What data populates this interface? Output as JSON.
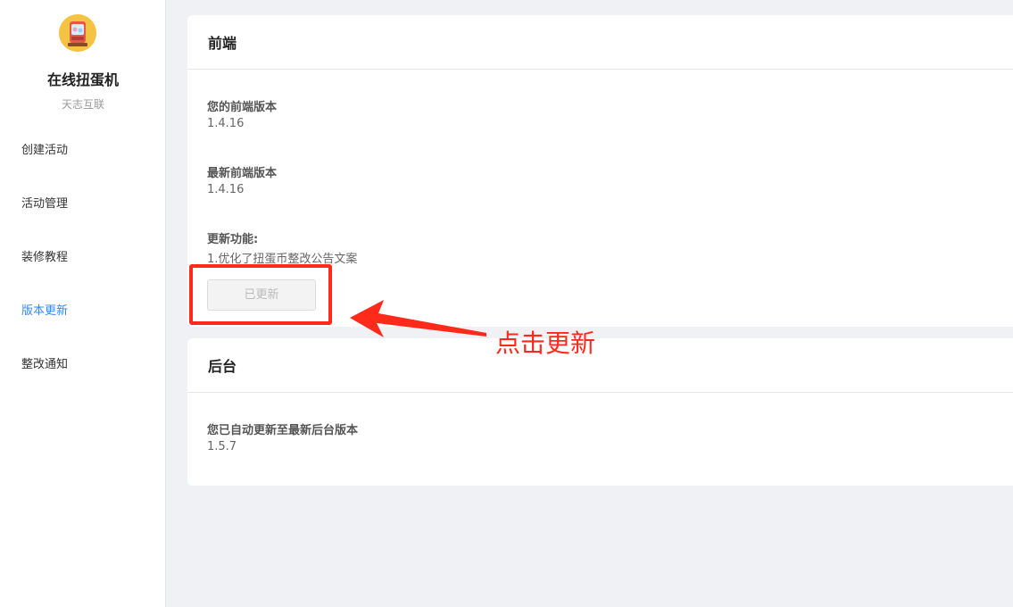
{
  "sidebar": {
    "app_name": "在线扭蛋机",
    "app_sub": "天志互联",
    "items": [
      {
        "label": "创建活动"
      },
      {
        "label": "活动管理"
      },
      {
        "label": "装修教程"
      },
      {
        "label": "版本更新"
      },
      {
        "label": "整改通知"
      }
    ],
    "active_index": 3
  },
  "frontend": {
    "title": "前端",
    "current_label": "您的前端版本",
    "current_value": "1.4.16",
    "latest_label": "最新前端版本",
    "latest_value": "1.4.16",
    "changes_label": "更新功能:",
    "changes_value": "1.优化了扭蛋币整改公告文案",
    "button_label": "已更新"
  },
  "backend": {
    "title": "后台",
    "status_label": "您已自动更新至最新后台版本",
    "status_value": "1.5.7"
  },
  "annotation": {
    "text": "点击更新",
    "color": "#ff2a1a"
  },
  "colors": {
    "accent": "#3388ff",
    "background": "#f0f1f5"
  }
}
